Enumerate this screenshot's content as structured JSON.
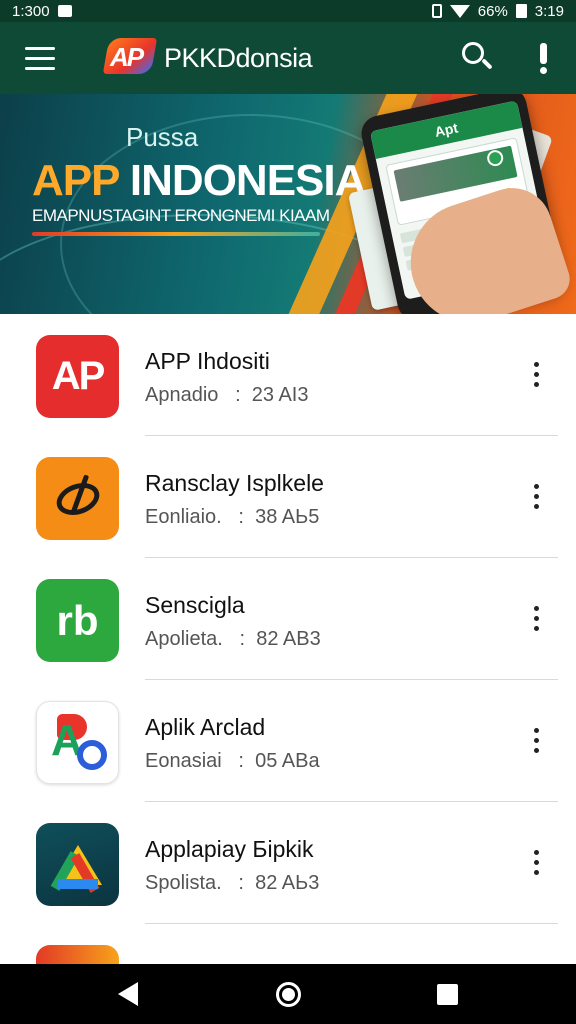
{
  "status_bar": {
    "time_left": "1:300",
    "battery": "66%",
    "time_right": "3:19"
  },
  "app_bar": {
    "logo_text": "AP",
    "title": "PKKDdonsia"
  },
  "banner": {
    "kicker": "Pussa",
    "title_part1": "APP",
    "title_part2": "INDONESIA",
    "subtitle": "EMAPNUSTAGINT ERONGNEMI KIAAM",
    "phone_header": "Apt"
  },
  "apps": [
    {
      "name": "APP Ihdositi",
      "category": "Apnadio",
      "separator": ":",
      "size": "23 AI3",
      "icon": "ap-logo-icon",
      "icon_text": "AP"
    },
    {
      "name": "Ransclay Isplkele",
      "category": "Eonliaio.",
      "separator": ":",
      "size": "38 AЬ5",
      "icon": "ring-tool-icon"
    },
    {
      "name": "Senscigla",
      "category": "Apolieta.",
      "separator": ":",
      "size": "82 AB3",
      "icon": "rb-logo-icon",
      "icon_text": "rb"
    },
    {
      "name": "Aplik Arclad",
      "category": "Eonasiai",
      "separator": ":",
      "size": "05 ABa",
      "icon": "ab-logo-icon",
      "icon_text": "A"
    },
    {
      "name": "Applapiay Бipkik",
      "category": "Spolista.",
      "separator": ":",
      "size": "82 AЬ3",
      "icon": "triangle-drive-icon"
    }
  ]
}
